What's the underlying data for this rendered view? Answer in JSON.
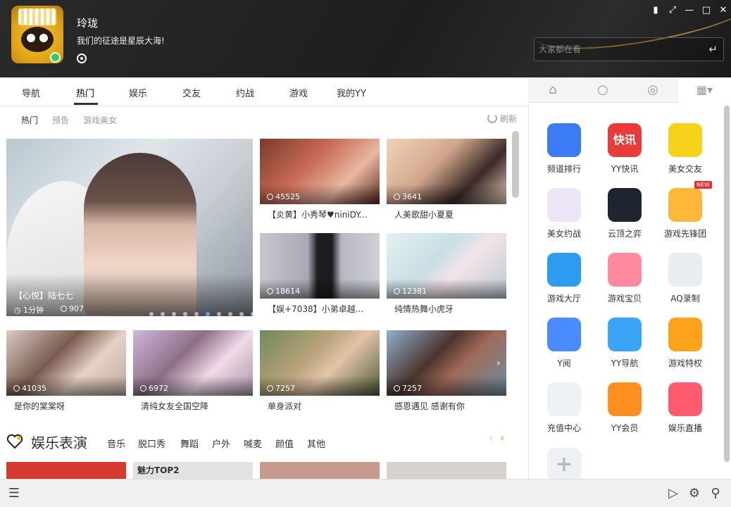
{
  "header": {
    "username": "玲珑",
    "motto": "我们的征途是星辰大海!",
    "search_placeholder": "大家都在看",
    "window_controls": [
      "skin-icon",
      "mini-icon",
      "minimize-icon",
      "maximize-icon",
      "close-icon"
    ]
  },
  "nav": {
    "tabs": [
      "导航",
      "热门",
      "娱乐",
      "交友",
      "约战",
      "游戏",
      "我的YY"
    ],
    "active": "热门"
  },
  "subnav": {
    "tabs": [
      "热门",
      "预告",
      "游戏美女"
    ],
    "refresh": "刷新"
  },
  "feature": {
    "title": "【心悦】陆七七",
    "duration": "1分钟",
    "viewers": "907",
    "carousel_dots": 10,
    "active_dot": 6
  },
  "cards": [
    {
      "viewers": "45525",
      "title": "【炎黄】小秀琴♥niniDY..."
    },
    {
      "viewers": "3641",
      "title": "人美歌甜小夏夏"
    },
    {
      "viewers": "18614",
      "title": "【娱+7038】小弟卓越..."
    },
    {
      "viewers": "12381",
      "title": "纯情热舞小虎牙"
    },
    {
      "viewers": "41035",
      "title": "是你的棠棠呀"
    },
    {
      "viewers": "6972",
      "title": "清纯女友全国空降"
    },
    {
      "viewers": "7257",
      "title": "单身派对"
    },
    {
      "viewers": "7257",
      "title": "感恩遇见 感谢有你"
    }
  ],
  "section": {
    "title": "娱乐表演",
    "categories": [
      "音乐",
      "脱口秀",
      "舞蹈",
      "户外",
      "喊麦",
      "颜值",
      "其他"
    ],
    "thumb_text": "魅力TOP2"
  },
  "apps": [
    {
      "label": "频道排行",
      "color": "#3b7cf5"
    },
    {
      "label": "YY快讯",
      "color": "#ea3b3b",
      "icon_text": "快讯"
    },
    {
      "label": "美女交友",
      "color": "#f7d21a"
    },
    {
      "label": "美女约战",
      "color": "#ece6f7"
    },
    {
      "label": "云顶之弈",
      "color": "#1f2530"
    },
    {
      "label": "游戏先锋团",
      "color": "#ffb73a",
      "badge": "NEW"
    },
    {
      "label": "游戏大厅",
      "color": "#2d9cf0"
    },
    {
      "label": "游戏宝贝",
      "color": "#ff8aa0"
    },
    {
      "label": "AQ录制",
      "color": "#e9edf2"
    },
    {
      "label": "Y阅",
      "color": "#4a8cff"
    },
    {
      "label": "YY导航",
      "color": "#3aa4f8"
    },
    {
      "label": "游戏特权",
      "color": "#ffa21c"
    },
    {
      "label": "充值中心",
      "color": "#eef2f6"
    },
    {
      "label": "YY会员",
      "color": "#ff8f1f"
    },
    {
      "label": "娱乐直播",
      "color": "#ff5a6e"
    }
  ]
}
